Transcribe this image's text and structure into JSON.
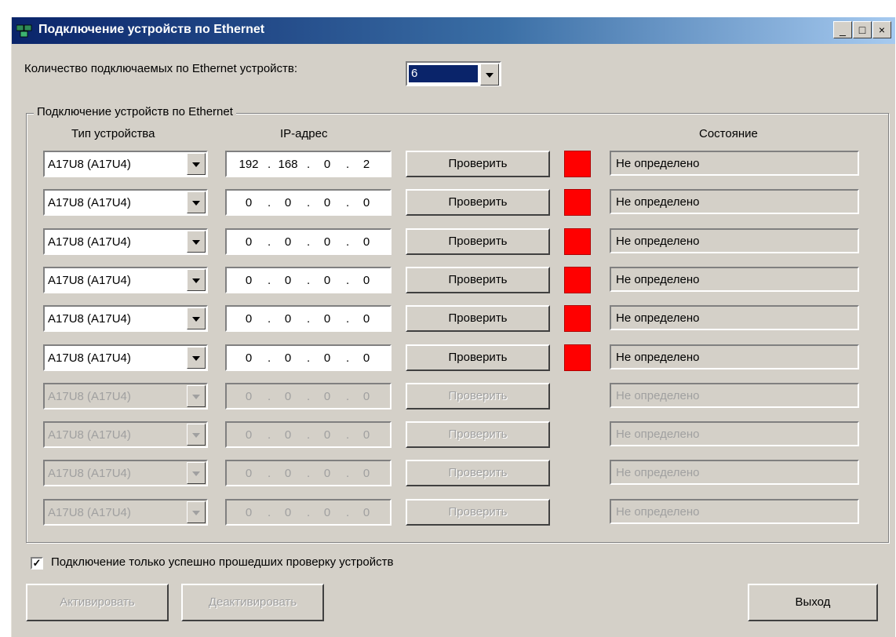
{
  "window": {
    "title": "Подключение устройств по Ethernet",
    "minimize": "_",
    "maximize": "□",
    "close": "×"
  },
  "count": {
    "label": "Количество подключаемых по Ethernet устройств:",
    "value": "6"
  },
  "group": {
    "title": "Подключение устройств по Ethernet",
    "col_type": "Тип устройства",
    "col_ip": "IP-адрес",
    "col_state": "Состояние"
  },
  "rows": [
    {
      "type": "A17U8 (A17U4)",
      "ip": [
        "192",
        "168",
        "0",
        "2"
      ],
      "button": "Проверить",
      "state": "Не определено",
      "enabled": true,
      "led_color": "#ff0000"
    },
    {
      "type": "A17U8 (A17U4)",
      "ip": [
        "0",
        "0",
        "0",
        "0"
      ],
      "button": "Проверить",
      "state": "Не определено",
      "enabled": true,
      "led_color": "#ff0000"
    },
    {
      "type": "A17U8 (A17U4)",
      "ip": [
        "0",
        "0",
        "0",
        "0"
      ],
      "button": "Проверить",
      "state": "Не определено",
      "enabled": true,
      "led_color": "#ff0000"
    },
    {
      "type": "A17U8 (A17U4)",
      "ip": [
        "0",
        "0",
        "0",
        "0"
      ],
      "button": "Проверить",
      "state": "Не определено",
      "enabled": true,
      "led_color": "#ff0000"
    },
    {
      "type": "A17U8 (A17U4)",
      "ip": [
        "0",
        "0",
        "0",
        "0"
      ],
      "button": "Проверить",
      "state": "Не определено",
      "enabled": true,
      "led_color": "#ff0000"
    },
    {
      "type": "A17U8 (A17U4)",
      "ip": [
        "0",
        "0",
        "0",
        "0"
      ],
      "button": "Проверить",
      "state": "Не определено",
      "enabled": true,
      "led_color": "#ff0000"
    },
    {
      "type": "A17U8 (A17U4)",
      "ip": [
        "0",
        "0",
        "0",
        "0"
      ],
      "button": "Проверить",
      "state": "Не определено",
      "enabled": false
    },
    {
      "type": "A17U8 (A17U4)",
      "ip": [
        "0",
        "0",
        "0",
        "0"
      ],
      "button": "Проверить",
      "state": "Не определено",
      "enabled": false
    },
    {
      "type": "A17U8 (A17U4)",
      "ip": [
        "0",
        "0",
        "0",
        "0"
      ],
      "button": "Проверить",
      "state": "Не определено",
      "enabled": false
    },
    {
      "type": "A17U8 (A17U4)",
      "ip": [
        "0",
        "0",
        "0",
        "0"
      ],
      "button": "Проверить",
      "state": "Не определено",
      "enabled": false
    }
  ],
  "checkbox": {
    "label": "Подключение только успешно прошедших проверку устройств",
    "checked": true,
    "mark": "✓"
  },
  "buttons": {
    "activate": "Активировать",
    "deactivate": "Деактивировать",
    "exit": "Выход"
  }
}
